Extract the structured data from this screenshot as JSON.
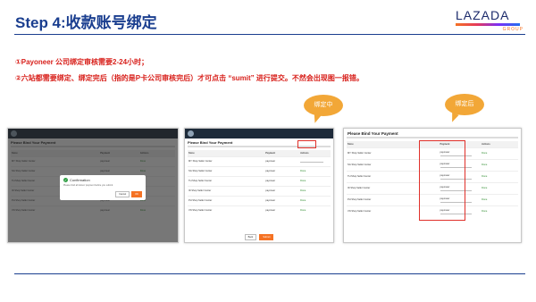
{
  "header": {
    "title": "Step 4:收款账号绑定",
    "logo": {
      "word": "LAZADA",
      "group": "GROUP"
    }
  },
  "notes": [
    "①Payoneer 公司绑定审核需要2-24小时；",
    "②六站都需要绑定、绑定完后（指的是P卡公司审核完后）才可点击 “sumit” 进行提交。不然会出现图一报错。"
  ],
  "callouts": {
    "binding": "绑定中",
    "bound": "绑定后"
  },
  "panels": {
    "page_title": "Please Bind Your Payment",
    "columns": [
      "Store",
      "Payment",
      "Actions"
    ],
    "rows": [
      {
        "store": "MY Shop Seller Center",
        "payment": "payoneer",
        "status": "Done"
      },
      {
        "store": "SG Shop Seller Center",
        "payment": "payoneer",
        "status": "Done"
      },
      {
        "store": "TH Shop Seller Center",
        "payment": "payoneer",
        "status": "Done"
      },
      {
        "store": "ID Shop Seller Center",
        "payment": "payoneer",
        "status": "Done"
      },
      {
        "store": "PH Shop Seller Center",
        "payment": "payoneer",
        "status": "Done"
      },
      {
        "store": "VN Shop Seller Center",
        "payment": "payoneer",
        "status": "Done"
      }
    ],
    "dialog": {
      "title": "Confirmation",
      "body": "Please bind all stores' payment before you submit.",
      "cancel": "Cancel",
      "ok": "OK"
    },
    "pager": {
      "back": "Back",
      "submit": "Submit"
    }
  }
}
